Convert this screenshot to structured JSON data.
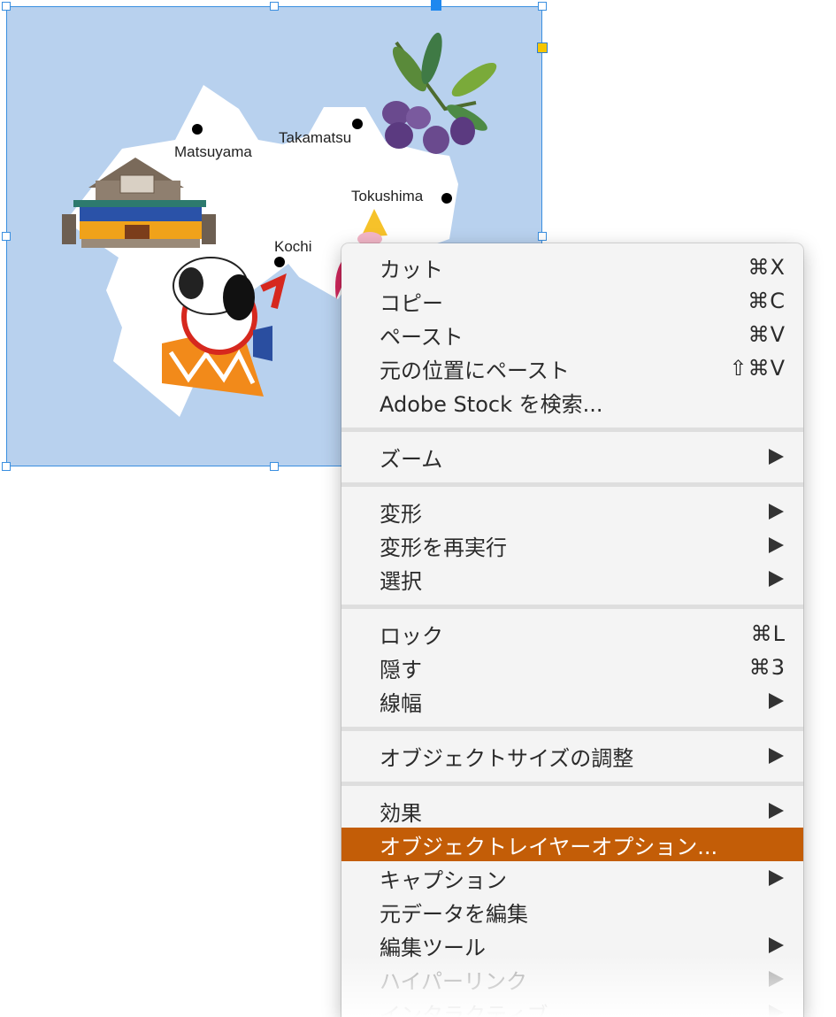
{
  "canvas": {
    "background_color": "#b8d1ee",
    "land_color": "#ffffff",
    "selection_color": "#3a8fe0",
    "cities": [
      {
        "name": "Matsuyama"
      },
      {
        "name": "Takamatsu"
      },
      {
        "name": "Tokushima"
      },
      {
        "name": "Kochi"
      }
    ],
    "illustrations": [
      "dogo-onsen-building-icon",
      "olive-branch-icon",
      "hariko-dog-icon"
    ]
  },
  "context_menu": {
    "highlight_color": "#c35d07",
    "groups": [
      [
        {
          "label": "カット",
          "shortcut": "⌘X"
        },
        {
          "label": "コピー",
          "shortcut": "⌘C"
        },
        {
          "label": "ペースト",
          "shortcut": "⌘V"
        },
        {
          "label": "元の位置にペースト",
          "shortcut": "⇧⌘V"
        },
        {
          "label": "Adobe Stock を検索..."
        }
      ],
      [
        {
          "label": "ズーム",
          "submenu": true
        }
      ],
      [
        {
          "label": "変形",
          "submenu": true
        },
        {
          "label": "変形を再実行",
          "submenu": true
        },
        {
          "label": "選択",
          "submenu": true
        }
      ],
      [
        {
          "label": "ロック",
          "shortcut": "⌘L"
        },
        {
          "label": "隠す",
          "shortcut": "⌘3"
        },
        {
          "label": "線幅",
          "submenu": true
        }
      ],
      [
        {
          "label": "オブジェクトサイズの調整",
          "submenu": true
        }
      ],
      [
        {
          "label": "効果",
          "submenu": true
        },
        {
          "label": "オブジェクトレイヤーオプション...",
          "highlighted": true
        },
        {
          "label": "キャプション",
          "submenu": true
        },
        {
          "label": "元データを編集"
        },
        {
          "label": "編集ツール",
          "submenu": true
        },
        {
          "label": "ハイパーリンク",
          "submenu": true,
          "disabled": true
        },
        {
          "label": "インタラクティブ",
          "submenu": true,
          "disabled": true
        }
      ]
    ]
  }
}
